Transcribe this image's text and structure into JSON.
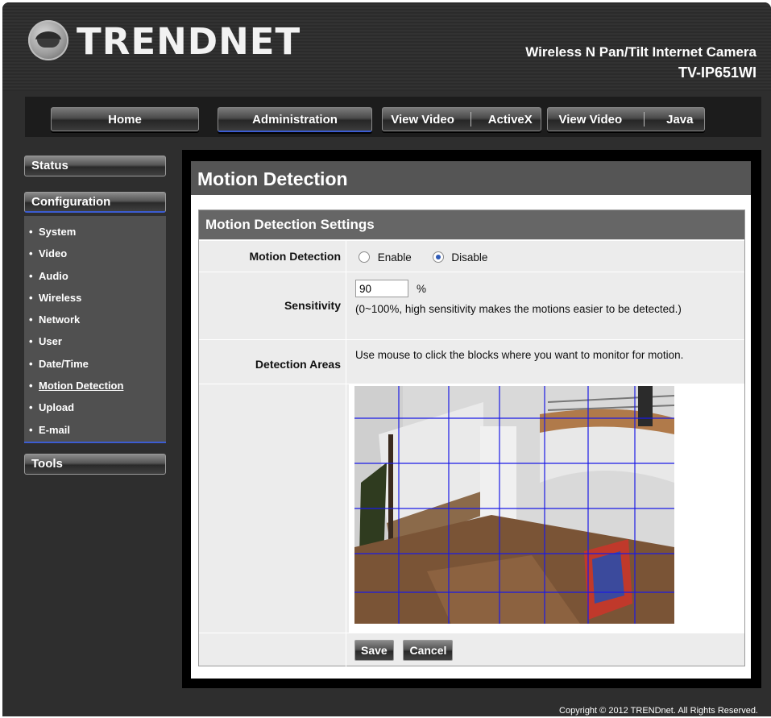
{
  "brand": {
    "logo_text": "TRENDNET",
    "product_name": "Wireless N Pan/Tilt Internet Camera",
    "model": "TV-IP651WI"
  },
  "nav": {
    "home": "Home",
    "administration": "Administration",
    "view_video_activex": [
      "View Video",
      "ActiveX"
    ],
    "view_video_java": [
      "View Video",
      "Java"
    ]
  },
  "sidebar": {
    "status": "Status",
    "configuration": "Configuration",
    "items": [
      {
        "label": "System"
      },
      {
        "label": "Video"
      },
      {
        "label": "Audio"
      },
      {
        "label": "Wireless"
      },
      {
        "label": "Network"
      },
      {
        "label": "User"
      },
      {
        "label": "Date/Time"
      },
      {
        "label": "Motion Detection"
      },
      {
        "label": "Upload"
      },
      {
        "label": "E-mail"
      }
    ],
    "tools": "Tools"
  },
  "page": {
    "title": "Motion Detection",
    "section_title": "Motion Detection Settings",
    "motion_detection": {
      "label": "Motion Detection",
      "enable_label": "Enable",
      "disable_label": "Disable",
      "selected": "Disable"
    },
    "sensitivity": {
      "label": "Sensitivity",
      "value": "90",
      "unit": "%",
      "help": "(0~100%, high sensitivity makes the motions easier to be detected.)"
    },
    "detection_areas": {
      "label": "Detection Areas",
      "help": "Use mouse to click the blocks where you want to monitor for motion."
    },
    "save_label": "Save",
    "cancel_label": "Cancel"
  },
  "footer": {
    "copyright": "Copyright © 2012 TRENDnet.  All Rights Reserved."
  },
  "colors": {
    "accent_blue": "#3c5cd1",
    "grid_line": "#1a1ae6",
    "panel_dark": "#555555"
  }
}
